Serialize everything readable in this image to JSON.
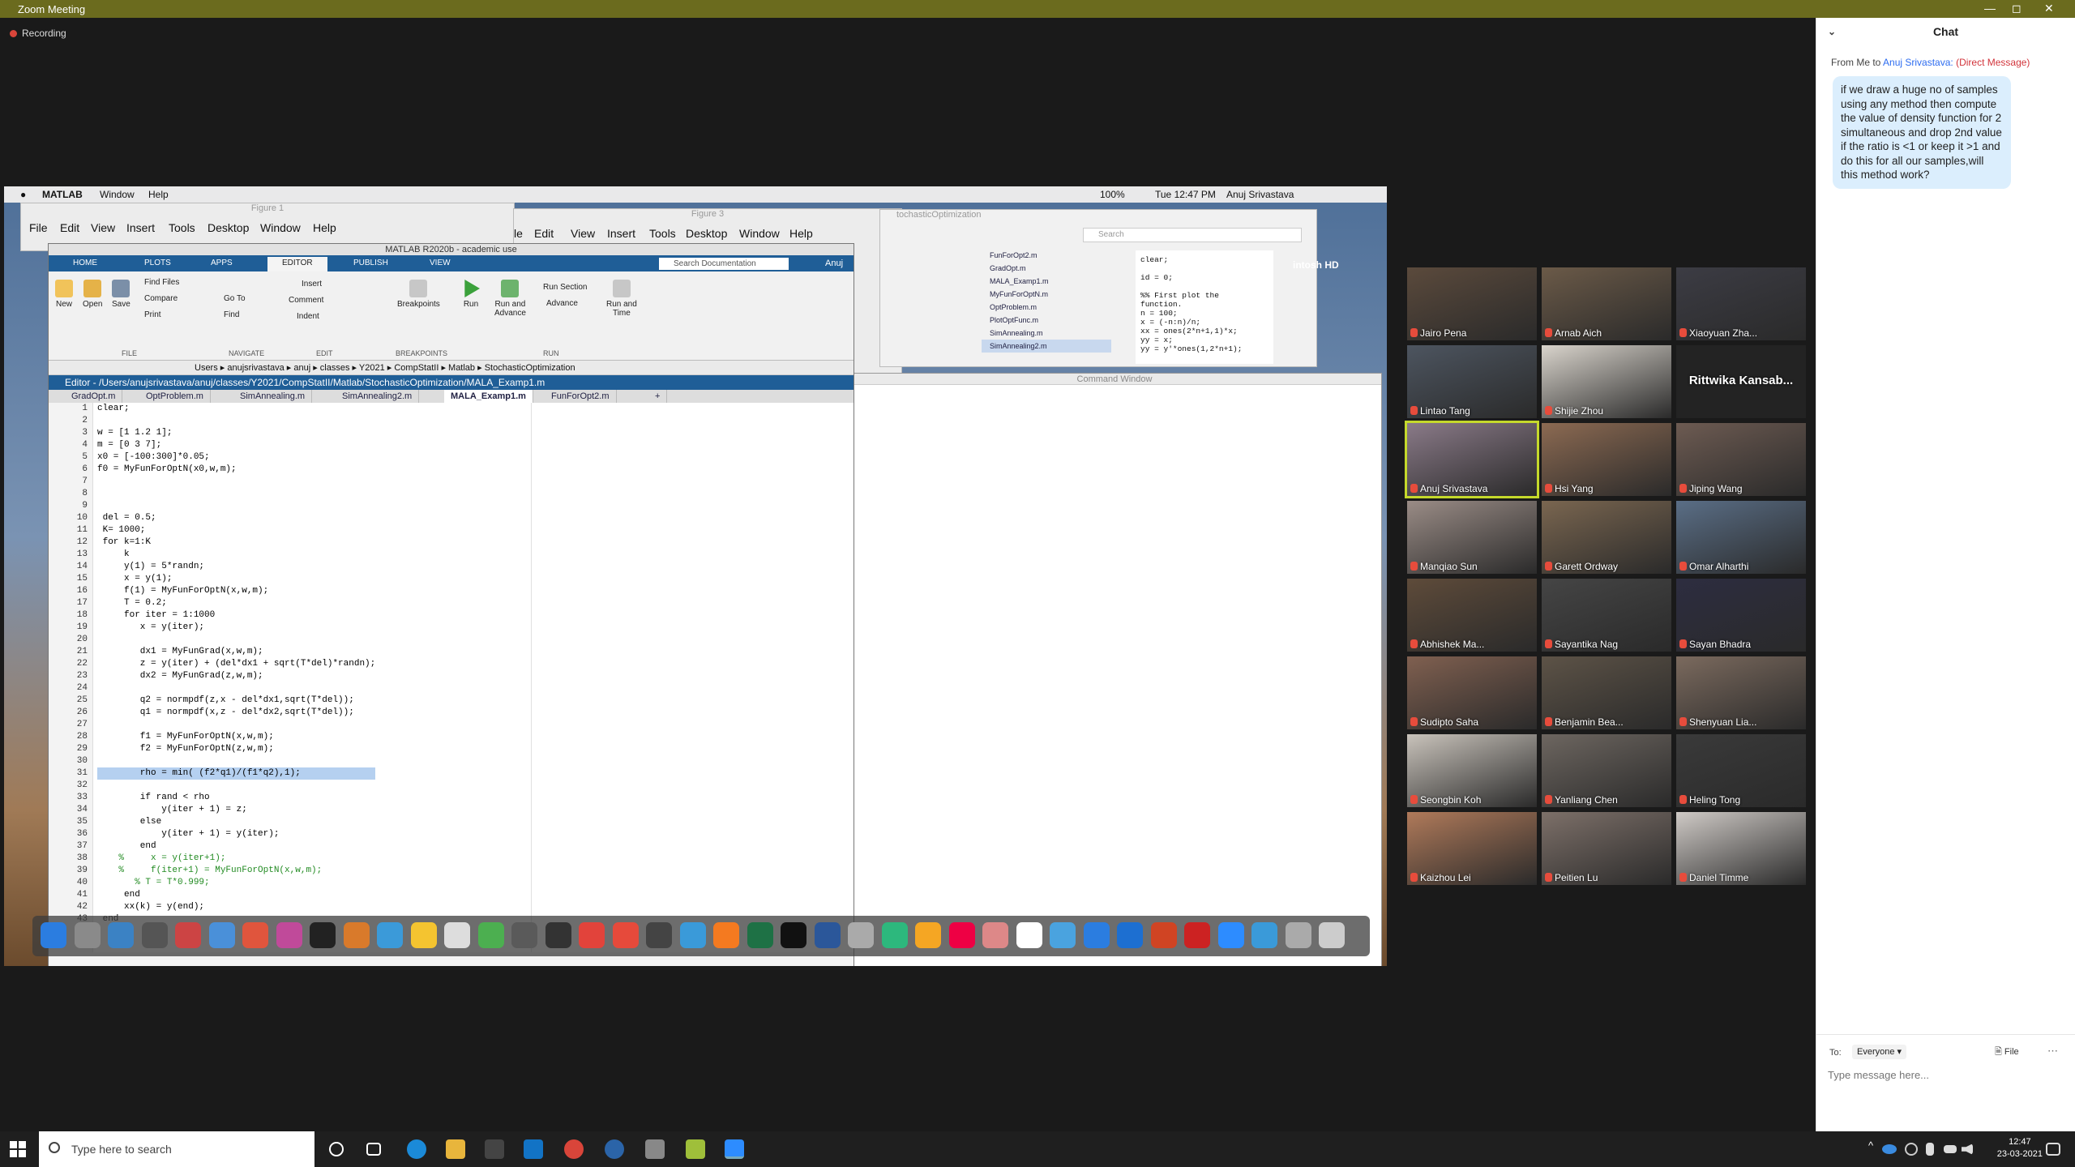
{
  "window": {
    "title": "Zoom Meeting"
  },
  "recording": {
    "label": "Recording"
  },
  "mac_menubar": {
    "app": "MATLAB",
    "items": [
      "Window",
      "Help"
    ],
    "battery": "100%",
    "time": "Tue 12:47 PM",
    "user": "Anuj Srivastava"
  },
  "figure1": {
    "title": "Figure 1",
    "menu": [
      "File",
      "Edit",
      "View",
      "Insert",
      "Tools",
      "Desktop",
      "Window",
      "Help"
    ]
  },
  "figure3": {
    "title": "Figure 3",
    "menu": [
      "le",
      "Edit",
      "View",
      "Insert",
      "Tools",
      "Desktop",
      "Window",
      "Help"
    ]
  },
  "stochastic": {
    "title": "tochasticOptimization",
    "search_placeholder": "Search",
    "files": [
      "FunForOpt2.m",
      "GradOpt.m",
      "MALA_Examp1.m",
      "MyFunForOptN.m",
      "OptProblem.m",
      "PlotOptFunc.m",
      "SimAnnealing.m",
      "SimAnnealing2.m"
    ],
    "preview": "clear;\n\nid = 0;\n\n%% First plot the\nfunction.\nn = 100;\nx = (-n:n)/n;\nxx = ones(2*n+1,1)*x;\nyy = x;\nyy = y'*ones(1,2*n+1);"
  },
  "desktop_label": "intosh HD",
  "command_window": {
    "title": "Command Window"
  },
  "matlab": {
    "title": "MATLAB R2020b - academic use",
    "tabs": [
      "HOME",
      "PLOTS",
      "APPS",
      "EDITOR",
      "PUBLISH",
      "VIEW"
    ],
    "search_placeholder": "Search Documentation",
    "user": "Anuj",
    "ribbon": {
      "new": "New",
      "open": "Open",
      "save": "Save",
      "find_files": "Find Files",
      "compare": "Compare",
      "print": "Print",
      "insert": "Insert",
      "comment": "Comment",
      "indent": "Indent",
      "goto": "Go To",
      "find": "Find",
      "breakpoints": "Breakpoints",
      "run": "Run",
      "run_and_advance": "Run and\nAdvance",
      "run_section": "Run Section",
      "advance": "Advance",
      "run_and_time": "Run and\nTime",
      "groups": [
        "FILE",
        "NAVIGATE",
        "EDIT",
        "BREAKPOINTS",
        "RUN"
      ]
    },
    "path": [
      "Users",
      "anujsrivastava",
      "anuj",
      "classes",
      "Y2021",
      "CompStatII",
      "Matlab",
      "StochasticOptimization"
    ],
    "editor_title": "Editor - /Users/anujsrivastava/anuj/classes/Y2021/CompStatII/Matlab/StochasticOptimization/MALA_Examp1.m",
    "file_tabs": [
      "GradOpt.m",
      "OptProblem.m",
      "SimAnnealing.m",
      "SimAnnealing2.m",
      "MALA_Examp1.m",
      "FunForOpt2.m"
    ],
    "active_tab": "MALA_Examp1.m",
    "code": [
      "clear;",
      "",
      "w = [1 1.2 1];",
      "m = [0 3 7];",
      "x0 = [-100:300]*0.05;",
      "f0 = MyFunForOptN(x0,w,m);",
      "",
      "",
      "",
      " del = 0.5;",
      " K= 1000;",
      " for k=1:K",
      "     k",
      "     y(1) = 5*randn;",
      "     x = y(1);",
      "     f(1) = MyFunForOptN(x,w,m);",
      "     T = 0.2;",
      "     for iter = 1:1000",
      "        x = y(iter);",
      "",
      "        dx1 = MyFunGrad(x,w,m);",
      "        z = y(iter) + (del*dx1 + sqrt(T*del)*randn);",
      "        dx2 = MyFunGrad(z,w,m);",
      "",
      "        q2 = normpdf(z,x - del*dx1,sqrt(T*del));",
      "        q1 = normpdf(x,z - del*dx2,sqrt(T*del));",
      "",
      "        f1 = MyFunForOptN(x,w,m);",
      "        f2 = MyFunForOptN(z,w,m);",
      "",
      "        rho = min( (f2*q1)/(f1*q2),1);",
      "",
      "        if rand < rho",
      "            y(iter + 1) = z;",
      "        else",
      "            y(iter + 1) = y(iter);",
      "        end",
      "    %     x = y(iter+1);",
      "    %     f(iter+1) = MyFunForOptN(x,w,m);",
      "       % T = T*0.999;",
      "     end",
      "     xx(k) = y(end);",
      " end"
    ]
  },
  "participants": [
    "Jairo Pena",
    "Arnab Aich",
    "Xiaoyuan Zha...",
    "Lintao Tang",
    "Shijie Zhou",
    "Rittwika Kansab...",
    "Anuj Srivastava",
    "Hsi Yang",
    "Jiping Wang",
    "Manqiao Sun",
    "Garett Ordway",
    "Omar Alharthi",
    "Abhishek Ma...",
    "Sayantika Nag",
    "Sayan Bhadra",
    "Sudipto Saha",
    "Benjamin Bea...",
    "Shenyuan Lia...",
    "Seongbin Koh",
    "Yanliang Chen",
    "Heling Tong",
    "Kaizhou Lei",
    "Peitien Lu",
    "Daniel Timme"
  ],
  "chat": {
    "title": "Chat",
    "from_prefix": "From Me to",
    "to_name": "Anuj Srivastava:",
    "dm": "(Direct Message)",
    "message": "if we draw a huge no of samples using any method then compute the value of density function for 2 simultaneous and drop 2nd value if the ratio is <1 or keep it >1 and do this for all our samples,will this method work?",
    "to_label": "To:",
    "to_value": "Everyone",
    "file_label": "File",
    "input_placeholder": "Type message here..."
  },
  "taskbar": {
    "search_placeholder": "Type here to search",
    "time": "12:47",
    "date": "23-03-2021"
  }
}
